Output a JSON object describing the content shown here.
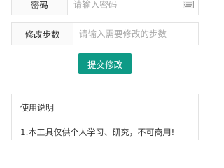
{
  "password_row": {
    "label": "密码",
    "placeholder": "请输入密码",
    "icon": "keyboard-icon"
  },
  "steps_row": {
    "label": "修改步数",
    "placeholder": "请输入需要修改的步数"
  },
  "submit": {
    "label": "提交修改",
    "color": "#0e9a86"
  },
  "help": {
    "title": "使用说明",
    "lines": [
      "1.本工具仅供个人学习、研究，不可商用!"
    ]
  }
}
